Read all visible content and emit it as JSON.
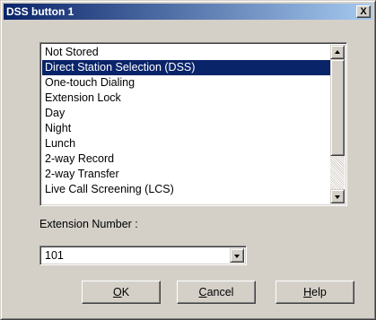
{
  "window": {
    "title": "DSS button  1",
    "close_glyph": "X"
  },
  "list": {
    "items": [
      "Not Stored",
      "Direct Station Selection (DSS)",
      "One-touch Dialing",
      "Extension Lock",
      "Day",
      "Night",
      "Lunch",
      "2-way Record",
      "2-way Transfer",
      "Live Call Screening (LCS)"
    ],
    "selected_index": 1
  },
  "extension": {
    "label": "Extension Number :",
    "value": "101"
  },
  "buttons": {
    "ok": {
      "mnemonic": "O",
      "rest": "K"
    },
    "cancel": {
      "mnemonic": "C",
      "rest": "ancel"
    },
    "help": {
      "mnemonic": "H",
      "rest": "elp"
    }
  },
  "icons": [
    "close-icon",
    "scroll-up-icon",
    "scroll-down-icon",
    "dropdown-arrow-icon"
  ],
  "colors": {
    "title_start": "#0a246a",
    "title_end": "#a6caf0",
    "selection": "#0a246a",
    "face": "#d4d0c8"
  }
}
